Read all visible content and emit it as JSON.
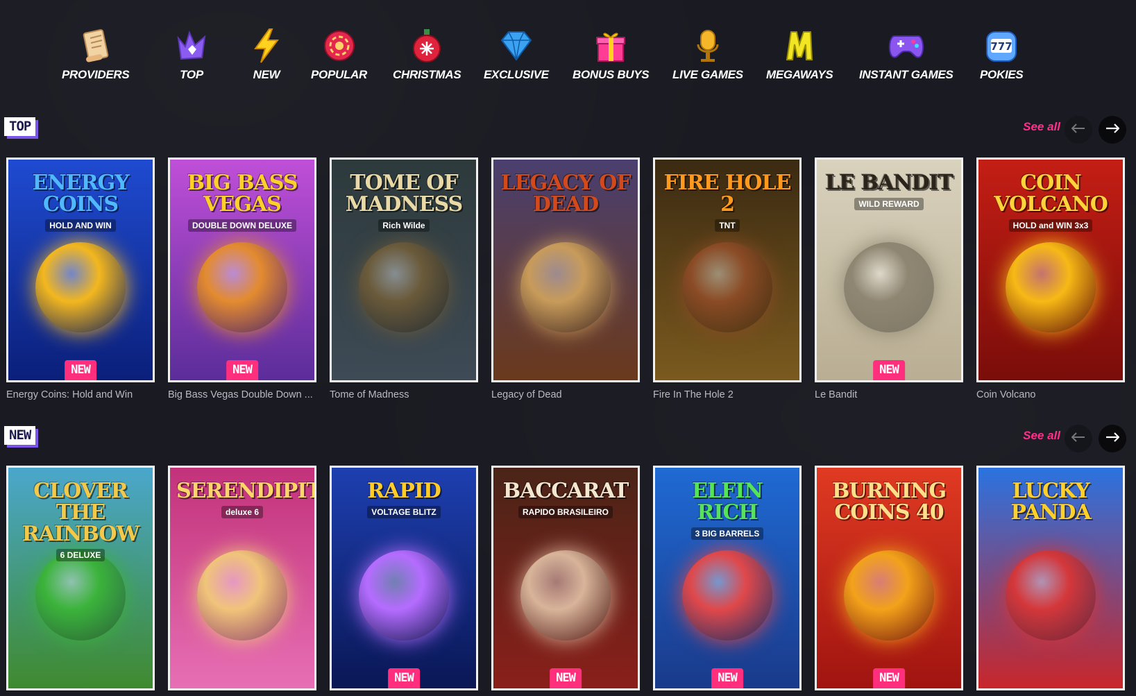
{
  "categories": [
    {
      "label": "PROVIDERS",
      "icon": "scroll-icon"
    },
    {
      "label": "TOP",
      "icon": "crown-icon"
    },
    {
      "label": "NEW",
      "icon": "lightning-icon"
    },
    {
      "label": "POPULAR",
      "icon": "chip-icon"
    },
    {
      "label": "CHRISTMAS",
      "icon": "ornament-icon"
    },
    {
      "label": "EXCLUSIVE",
      "icon": "diamond-icon"
    },
    {
      "label": "BONUS BUYS",
      "icon": "gift-icon"
    },
    {
      "label": "LIVE GAMES",
      "icon": "microphone-icon"
    },
    {
      "label": "MEGAWAYS",
      "icon": "m-letter-icon"
    },
    {
      "label": "INSTANT GAMES",
      "icon": "gamepad-icon"
    },
    {
      "label": "POKIES",
      "icon": "slot-machine-icon"
    }
  ],
  "sections": [
    {
      "badge": "TOP",
      "see_all": "See all",
      "games": [
        {
          "name": "Energy Coins: Hold and Win",
          "art_title": "ENERGY COINS",
          "art_sub": "HOLD AND WIN",
          "badge": "NEW",
          "bg_top": "#1f4bd1",
          "bg_bottom": "#0b1f7a",
          "title_color": "#4fb8ff",
          "orb": "#f3b71e"
        },
        {
          "name": "Big Bass Vegas Double Down ...",
          "art_title": "BIG BASS VEGAS",
          "art_sub": "DOUBLE DOWN DELUXE",
          "badge": "NEW",
          "bg_top": "#c04fd8",
          "bg_bottom": "#5b2d9a",
          "title_color": "#ffcf2a",
          "orb": "#e38b2f"
        },
        {
          "name": "Tome of Madness",
          "art_title": "TOME OF MADNESS",
          "art_sub": "Rich Wilde",
          "badge": "",
          "bg_top": "#2d3a3c",
          "bg_bottom": "#3e4a55",
          "title_color": "#e9d9a6",
          "orb": "#6a5a3a"
        },
        {
          "name": "Legacy of Dead",
          "art_title": "LEGACY OF DEAD",
          "art_sub": "",
          "badge": "",
          "bg_top": "#4a3f70",
          "bg_bottom": "#6b3a1c",
          "title_color": "#d24a1c",
          "orb": "#c89b5a"
        },
        {
          "name": "Fire In The Hole 2",
          "art_title": "FIRE HOLE 2",
          "art_sub": "TNT",
          "badge": "",
          "bg_top": "#3b2a12",
          "bg_bottom": "#7a5a1e",
          "title_color": "#ff9a1f",
          "orb": "#8a4b25"
        },
        {
          "name": "Le Bandit",
          "art_title": "LE BANDIT",
          "art_sub": "WILD REWARD",
          "badge": "NEW",
          "bg_top": "#d9d2bd",
          "bg_bottom": "#b9ae93",
          "title_color": "#2a241a",
          "orb": "#8f8672"
        },
        {
          "name": "Coin Volcano",
          "art_title": "COIN VOLCANO",
          "art_sub": "HOLD and WIN 3x3",
          "badge": "",
          "bg_top": "#c41e14",
          "bg_bottom": "#7a0d0a",
          "title_color": "#ffd33a",
          "orb": "#f6b915"
        }
      ]
    },
    {
      "badge": "NEW",
      "see_all": "See all",
      "games": [
        {
          "name": "",
          "art_title": "CLOVER THE RAINBOW",
          "art_sub": "6 DELUXE",
          "badge": "",
          "bg_top": "#4aa7cc",
          "bg_bottom": "#3f8a2e",
          "title_color": "#f2c94a",
          "orb": "#3bb33a"
        },
        {
          "name": "",
          "art_title": "SERENDIPITY",
          "art_sub": "deluxe 6",
          "badge": "",
          "bg_top": "#c2327a",
          "bg_bottom": "#e76fb4",
          "title_color": "#ffd56b",
          "orb": "#f0c47a"
        },
        {
          "name": "",
          "art_title": "RAPID",
          "art_sub": "VOLTAGE BLITZ",
          "badge": "NEW",
          "bg_top": "#1d3fb0",
          "bg_bottom": "#0a1755",
          "title_color": "#ffcc2a",
          "orb": "#b56cff"
        },
        {
          "name": "",
          "art_title": "BACCARAT",
          "art_sub": "RAPIDO BRASILEIRO",
          "badge": "NEW",
          "bg_top": "#4a2418",
          "bg_bottom": "#8a1f1a",
          "title_color": "#f4e7d0",
          "orb": "#d8b49a"
        },
        {
          "name": "",
          "art_title": "ELFIN RICH",
          "art_sub": "3 BIG BARRELS",
          "badge": "NEW",
          "bg_top": "#1f6ad4",
          "bg_bottom": "#1a3a8a",
          "title_color": "#55e35a",
          "orb": "#e0484a"
        },
        {
          "name": "",
          "art_title": "BURNING COINS 40",
          "art_sub": "",
          "badge": "NEW",
          "bg_top": "#e03a22",
          "bg_bottom": "#a01410",
          "title_color": "#ffe08a",
          "orb": "#f2a21a"
        },
        {
          "name": "",
          "art_title": "LUCKY PANDA",
          "art_sub": "",
          "badge": "",
          "bg_top": "#2a73e0",
          "bg_bottom": "#c9262a",
          "title_color": "#ffd02a",
          "orb": "#d4373a"
        }
      ]
    }
  ]
}
